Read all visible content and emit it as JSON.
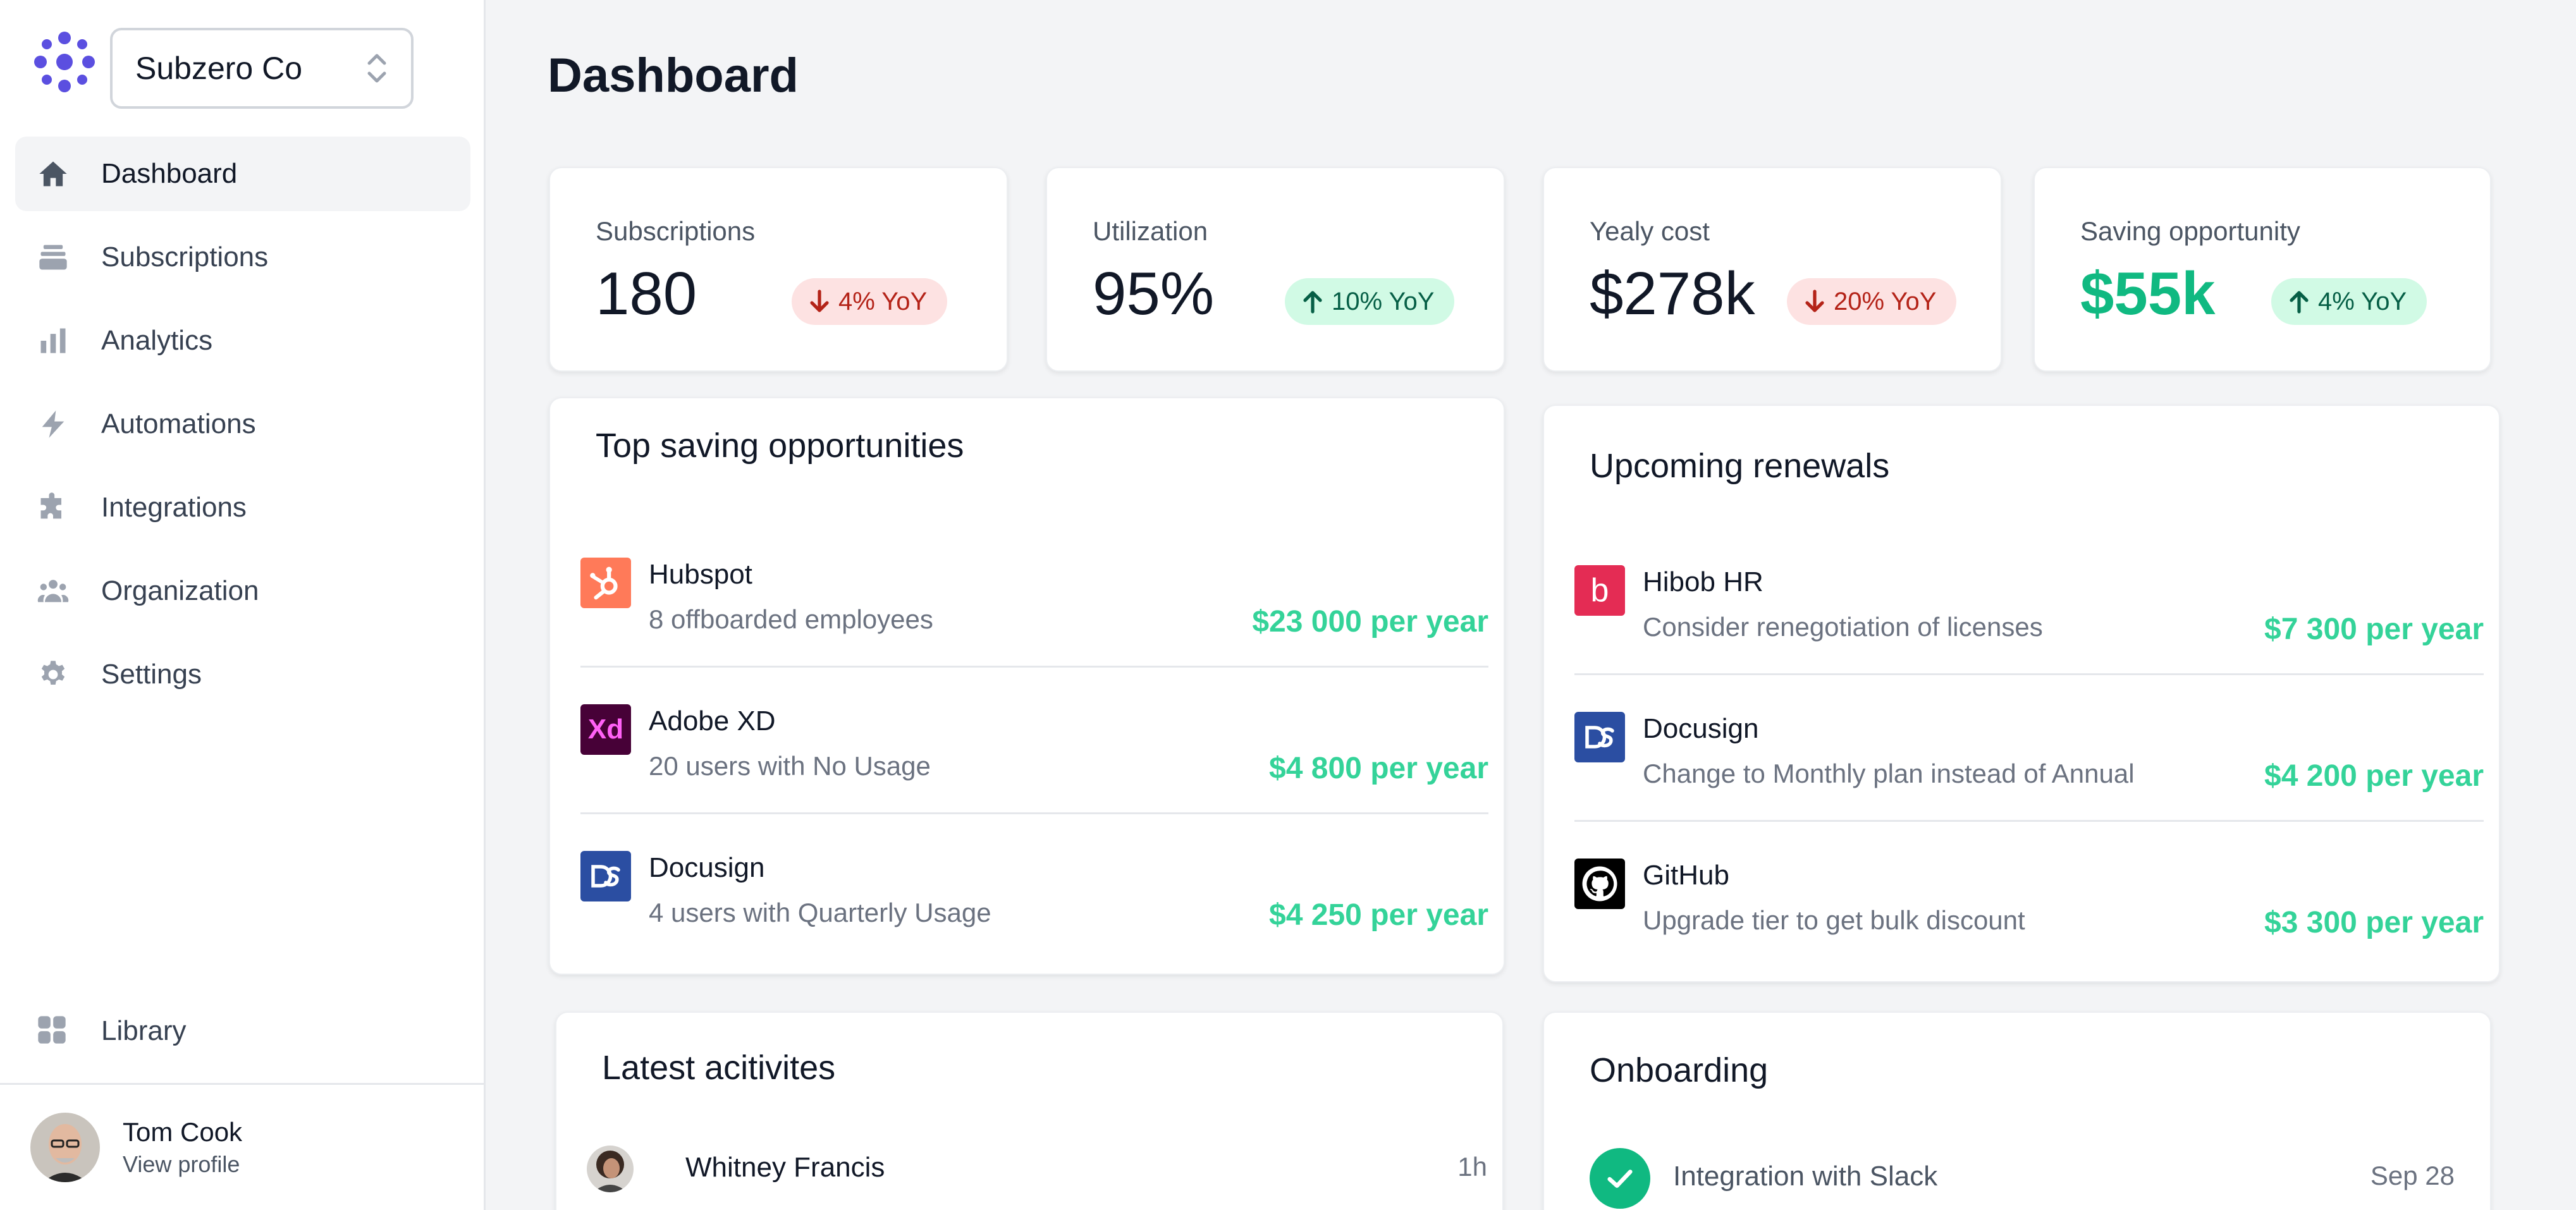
{
  "sidebar": {
    "org_name": "Subzero Co",
    "items": [
      {
        "label": "Dashboard",
        "icon": "home-icon",
        "active": true
      },
      {
        "label": "Subscriptions",
        "icon": "stack-icon"
      },
      {
        "label": "Analytics",
        "icon": "bar-chart-icon"
      },
      {
        "label": "Automations",
        "icon": "bolt-icon"
      },
      {
        "label": "Integrations",
        "icon": "puzzle-icon"
      },
      {
        "label": "Organization",
        "icon": "users-icon"
      },
      {
        "label": "Settings",
        "icon": "gear-icon"
      }
    ],
    "library_label": "Library",
    "profile": {
      "name": "Tom Cook",
      "sub": "View profile"
    }
  },
  "header": {
    "title": "Dashboard"
  },
  "stats": [
    {
      "label": "Subscriptions",
      "value": "180",
      "change": "4% YoY",
      "trend": "down"
    },
    {
      "label": "Utilization",
      "value": "95%",
      "change": "10% YoY",
      "trend": "up"
    },
    {
      "label": "Yealy cost",
      "value": "$278k",
      "change": "20% YoY",
      "trend": "down"
    },
    {
      "label": "Saving opportunity",
      "value": "$55k",
      "change": "4% YoY",
      "trend": "up"
    }
  ],
  "saving": {
    "title": "Top saving opportunities",
    "items": [
      {
        "name": "Hubspot",
        "desc": "8 offboarded employees",
        "amount": "$23 000 per year",
        "logo": "hubspot-logo"
      },
      {
        "name": "Adobe XD",
        "desc": "20 users with No Usage",
        "amount": "$4 800 per year",
        "logo": "adobe-xd-logo",
        "logo_text": "Xd"
      },
      {
        "name": "Docusign",
        "desc": "4 users with Quarterly Usage",
        "amount": "$4 250 per year",
        "logo": "docusign-logo"
      }
    ]
  },
  "renewals": {
    "title": "Upcoming renewals",
    "items": [
      {
        "name": "Hibob HR",
        "desc": "Consider renegotiation of licenses",
        "amount": "$7 300 per year",
        "logo": "hibob-logo",
        "logo_text": "b"
      },
      {
        "name": "Docusign",
        "desc": "Change to Monthly plan instead of Annual",
        "amount": "$4 200 per year",
        "logo": "docusign-logo"
      },
      {
        "name": "GitHub",
        "desc": "Upgrade tier to get bulk discount",
        "amount": "$3 300 per year",
        "logo": "github-logo"
      }
    ]
  },
  "activities": {
    "title": "Latest acitivites",
    "items": [
      {
        "name": "Whitney Francis",
        "time": "1h"
      }
    ]
  },
  "onboarding": {
    "title": "Onboarding",
    "items": [
      {
        "label": "Integration with Slack",
        "date": "Sep 28",
        "done": true
      }
    ]
  },
  "colors": {
    "accent": "#5b4fe0",
    "positive": "#10b981",
    "amount": "#34d399",
    "negative_badge_bg": "#fde2e2",
    "positive_badge_bg": "#d1fae5"
  }
}
